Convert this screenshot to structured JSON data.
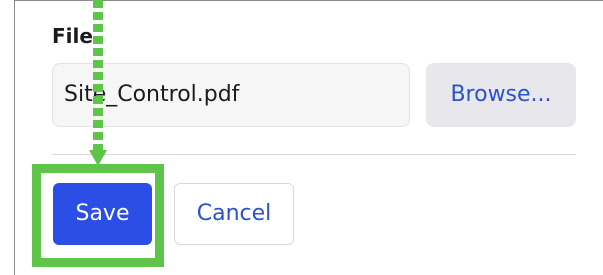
{
  "form": {
    "file_label": "File",
    "file_value": "Site_Control.pdf",
    "browse_label": "Browse...",
    "save_label": "Save",
    "cancel_label": "Cancel"
  },
  "annotation": {
    "highlight_color": "#5ec44a",
    "target": "save-button"
  },
  "colors": {
    "primary": "#2a4ee6",
    "link": "#2a52c9"
  }
}
